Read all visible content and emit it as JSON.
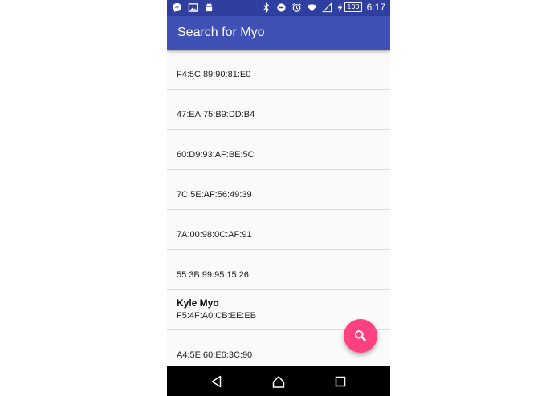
{
  "status_bar": {
    "left_icons": [
      "messenger-icon",
      "image-icon",
      "android-icon"
    ],
    "right_icons": [
      "bluetooth-icon",
      "do-not-disturb-icon",
      "alarm-icon",
      "wifi-icon",
      "signal-icon",
      "battery-charging-icon"
    ],
    "battery": "100",
    "time": "6:17"
  },
  "app_bar": {
    "title": "Search for Myo"
  },
  "devices": [
    {
      "name": "",
      "mac": "F4:5C:89:90:81:E0"
    },
    {
      "name": "",
      "mac": "47:EA:75:B9:DD:B4"
    },
    {
      "name": "",
      "mac": "60:D9:93:AF:BE:5C"
    },
    {
      "name": "",
      "mac": "7C:5E:AF:56:49:39"
    },
    {
      "name": "",
      "mac": "7A:00:98:0C:AF:91"
    },
    {
      "name": "",
      "mac": "55:3B:99:95:15:26"
    },
    {
      "name": "Kyle Myo",
      "mac": "F5:4F:A0:CB:EE:EB"
    },
    {
      "name": "",
      "mac": "A4:5E:60:E6:3C:90"
    }
  ],
  "fab": {
    "icon": "search-icon"
  },
  "nav_bar": {
    "icons": [
      "back-icon",
      "home-icon",
      "recents-icon"
    ]
  },
  "colors": {
    "status_bar": "#303f9f",
    "app_bar": "#3f51b5",
    "fab": "#ff4081",
    "list_bg": "#fafafa"
  }
}
